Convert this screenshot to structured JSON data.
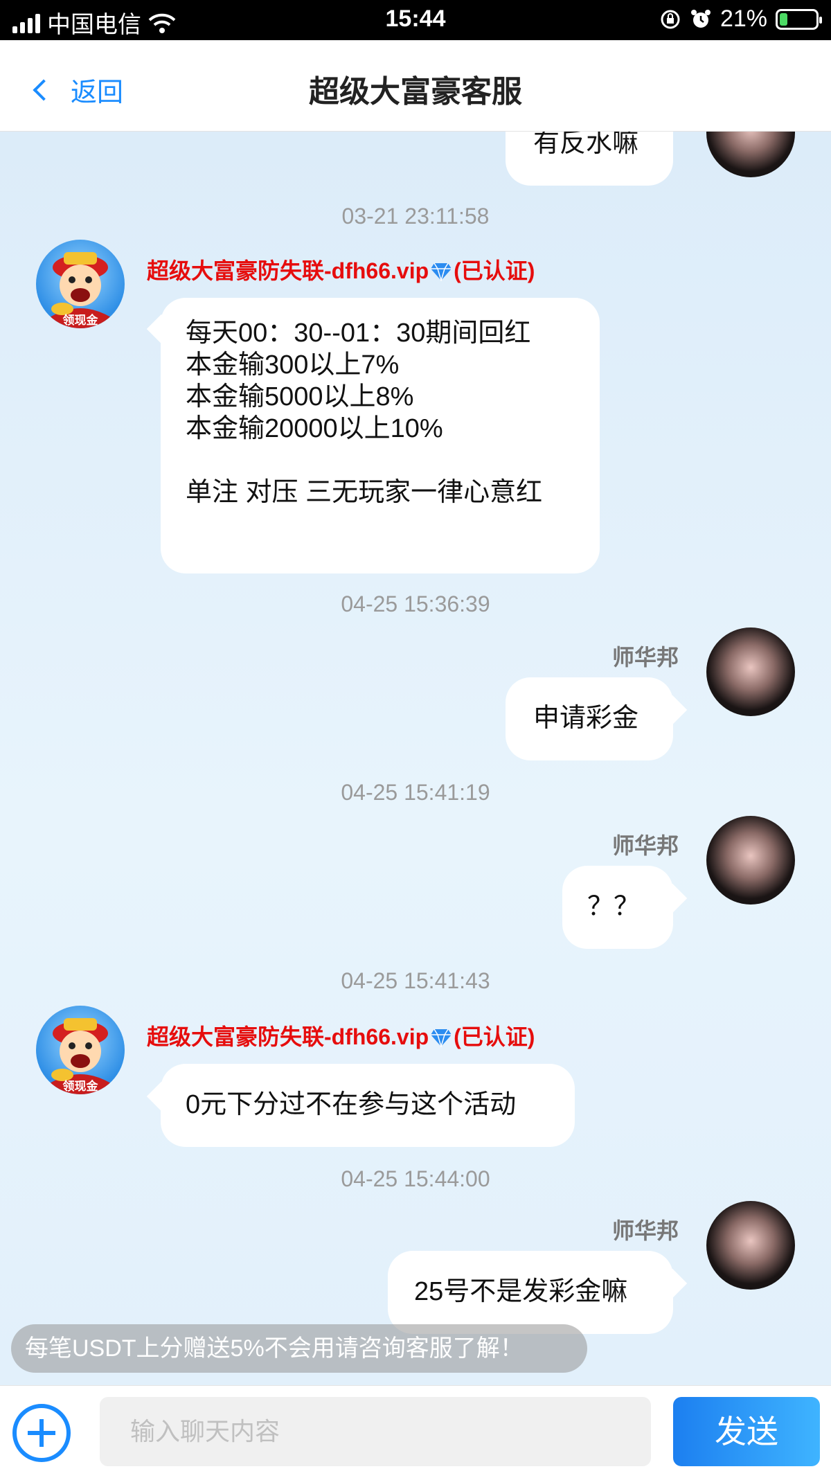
{
  "status_bar": {
    "carrier": "中国电信",
    "time": "15:44",
    "battery": "21%",
    "battery_level": 0.21
  },
  "header": {
    "back_label": "返回",
    "title": "超级大富豪客服"
  },
  "messages": {
    "m0": {
      "text": "有反水嘛"
    },
    "ts1": "03-21 23:11:58",
    "m1": {
      "sender": "超级大富豪防失联-dfh66.vip",
      "verified": "(已认证)",
      "lines": [
        "每天00：30--01：30期间回红",
        "本金输300以上7%",
        "本金输5000以上8%",
        "本金输20000以上10%",
        "",
        "单注 对压 三无玩家一律心意红"
      ]
    },
    "ts2": "04-25 15:36:39",
    "m2": {
      "sender": "师华邦",
      "text": "申请彩金"
    },
    "ts3": "04-25 15:41:19",
    "m3": {
      "sender": "师华邦",
      "text": "？？"
    },
    "ts4": "04-25 15:41:43",
    "m4": {
      "sender": "超级大富豪防失联-dfh66.vip",
      "verified": "(已认证)",
      "text": "0元下分过不在参与这个活动"
    },
    "ts5": "04-25 15:44:00",
    "m5": {
      "sender": "师华邦",
      "text": "25号不是发彩金嘛"
    }
  },
  "avatar_text": "领现金",
  "notice": "每笔USDT上分赠送5%不会用请咨询客服了解！",
  "input": {
    "placeholder": "输入聊天内容",
    "value": ""
  },
  "send_label": "发送",
  "colors": {
    "accent": "#1a8cff",
    "bot_name": "#e60d0d"
  }
}
